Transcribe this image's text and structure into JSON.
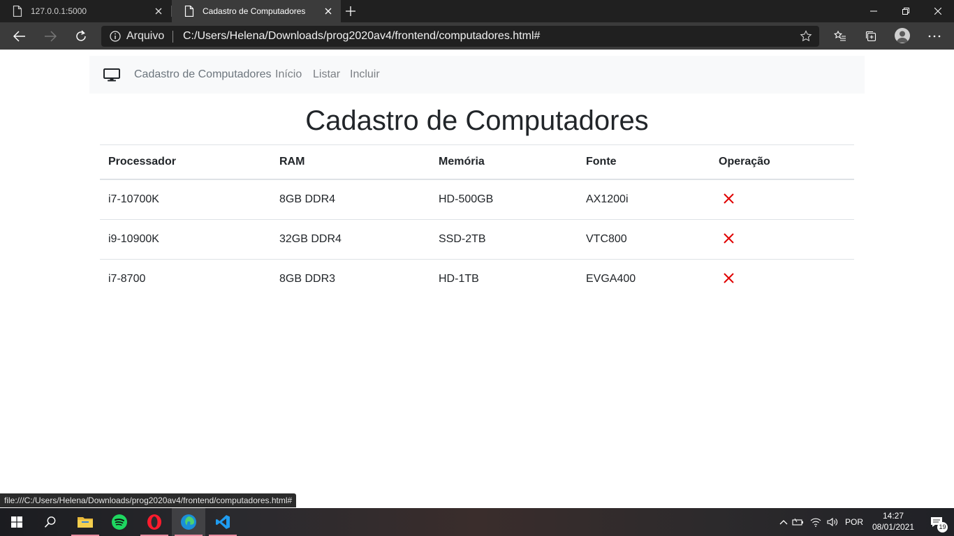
{
  "browser": {
    "tabs": [
      {
        "title": "127.0.0.1:5000",
        "active": false
      },
      {
        "title": "Cadastro de Computadores",
        "active": true
      }
    ],
    "address": {
      "scheme_label": "Arquivo",
      "url": "C:/Users/Helena/Downloads/prog2020av4/frontend/computadores.html#"
    },
    "status_url": "file:///C:/Users/Helena/Downloads/prog2020av4/frontend/computadores.html#"
  },
  "navbar": {
    "brand": "Cadastro de Computadores",
    "links": [
      "Início",
      "Listar",
      "Incluir"
    ]
  },
  "page": {
    "title": "Cadastro de Computadores"
  },
  "table": {
    "headers": [
      "Processador",
      "RAM",
      "Memória",
      "Fonte",
      "Operação"
    ],
    "rows": [
      [
        "i7-10700K",
        "8GB DDR4",
        "HD-500GB",
        "AX1200i"
      ],
      [
        "i9-10900K",
        "32GB DDR4",
        "SSD-2TB",
        "VTC800"
      ],
      [
        "i7-8700",
        "8GB DDR3",
        "HD-1TB",
        "EVGA400"
      ]
    ]
  },
  "taskbar": {
    "apps": [
      "file-explorer",
      "spotify",
      "opera",
      "edge",
      "vscode"
    ],
    "language": "POR",
    "time": "14:27",
    "date": "08/01/2021",
    "notification_count": "19"
  },
  "colors": {
    "delete_icon": "#e00000",
    "navbar_bg": "#f8f9fa",
    "browser_dark": "#202020",
    "browser_toolbar": "#3b3b3b"
  }
}
